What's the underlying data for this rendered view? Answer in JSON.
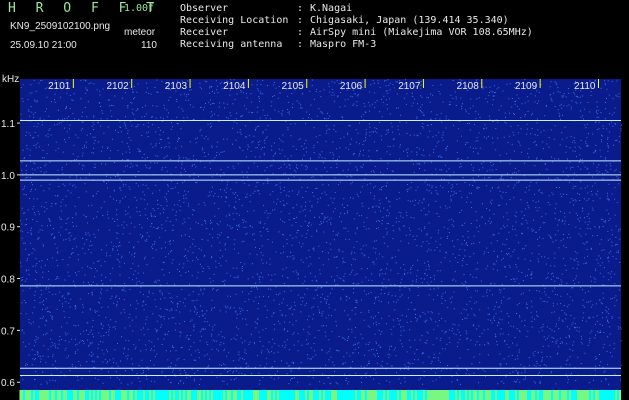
{
  "header": {
    "brand": "H R O F F T",
    "version": "1.00f",
    "file_name": "KN9_2509102100.png",
    "file_type": "meteor",
    "date_time": "25.09.10 21:00",
    "frame_number": "110"
  },
  "meta": [
    {
      "label": "Observer",
      "value": "K.Nagai"
    },
    {
      "label": "Receiving Location",
      "value": "Chigasaki, Japan (139.414 35.340)"
    },
    {
      "label": "Receiver",
      "value": "AirSpy mini (Miakejima VOR 108.65MHz)"
    },
    {
      "label": "Receiving antenna",
      "value": "Maspro FM-3"
    }
  ],
  "meta_separator": ":",
  "chart_data": {
    "type": "heatmap",
    "ylabel": "kHz",
    "x_ticks": [
      "2101",
      "2102",
      "2103",
      "2104",
      "2105",
      "2106",
      "2107",
      "2108",
      "2109",
      "2110"
    ],
    "y_ticks": [
      1.1,
      1.0,
      0.9,
      0.8,
      0.7,
      0.6
    ],
    "ylim": [
      0.585,
      1.185
    ],
    "signal_lines_khz": [
      1.105,
      1.027,
      1.0,
      0.99,
      0.786,
      0.627,
      0.613
    ],
    "colors": {
      "background": "#0a1c8c",
      "noise": "#3a6ef0",
      "line": "#c8f0ff",
      "bottom_strip": "#00ffff",
      "bottom_ticks": "#f0f000"
    }
  }
}
